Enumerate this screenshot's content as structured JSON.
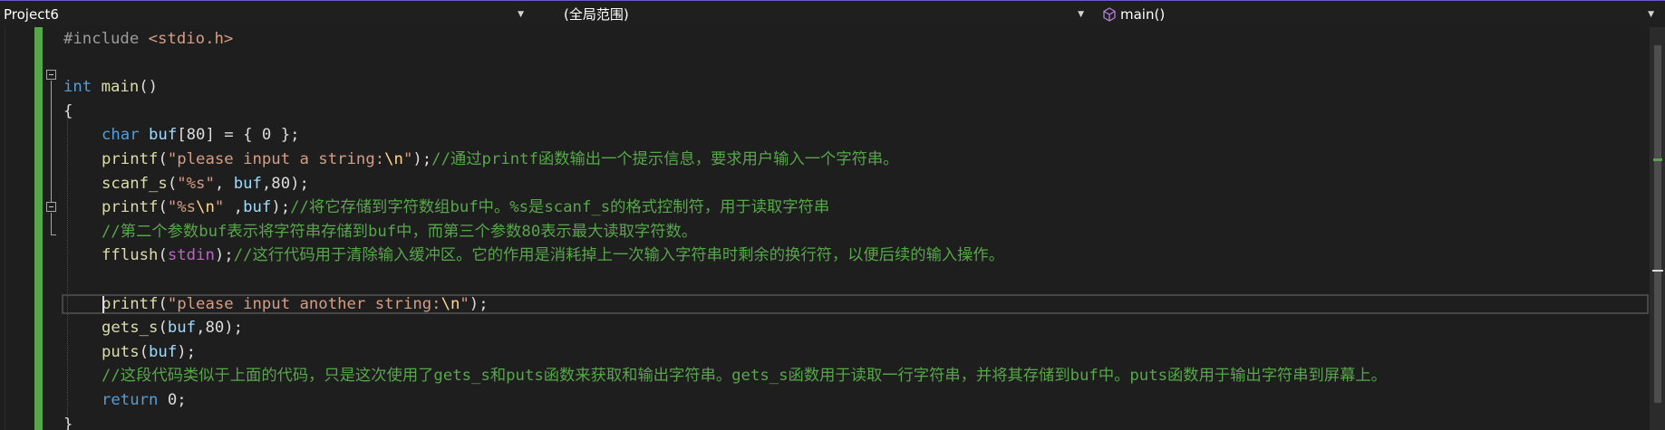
{
  "navbar": {
    "project": "Project6",
    "scope": "(全局范围)",
    "member": "main()",
    "member_icon": "method-cube-icon",
    "accent": "#6a5acd"
  },
  "editor": {
    "change_bar_color": "#57a64a",
    "lines": [
      {
        "segments": [
          {
            "c": "pp",
            "t": "#include "
          },
          {
            "c": "str",
            "t": "<stdio.h>"
          }
        ]
      },
      {
        "segments": []
      },
      {
        "segments": [
          {
            "c": "kw",
            "t": "int"
          },
          {
            "c": "",
            "t": " "
          },
          {
            "c": "fn",
            "t": "main"
          },
          {
            "c": "",
            "t": "()"
          }
        ]
      },
      {
        "segments": [
          {
            "c": "",
            "t": "{"
          }
        ]
      },
      {
        "indent": true,
        "segments": [
          {
            "c": "kw",
            "t": "char"
          },
          {
            "c": "",
            "t": " "
          },
          {
            "c": "var",
            "t": "buf"
          },
          {
            "c": "",
            "t": "[80] = { 0 };"
          }
        ]
      },
      {
        "indent": true,
        "segments": [
          {
            "c": "fn",
            "t": "printf"
          },
          {
            "c": "",
            "t": "("
          },
          {
            "c": "str",
            "t": "\"please input a string:"
          },
          {
            "c": "esc",
            "t": "\\n"
          },
          {
            "c": "str",
            "t": "\""
          },
          {
            "c": "",
            "t": ");"
          },
          {
            "c": "cmt",
            "t": "//通过printf函数输出一个提示信息，要求用户输入一个字符串。"
          }
        ]
      },
      {
        "indent": true,
        "segments": [
          {
            "c": "fn",
            "t": "scanf_s"
          },
          {
            "c": "",
            "t": "("
          },
          {
            "c": "str",
            "t": "\"%s\""
          },
          {
            "c": "",
            "t": ", "
          },
          {
            "c": "var",
            "t": "buf"
          },
          {
            "c": "",
            "t": ",80);"
          }
        ]
      },
      {
        "indent": true,
        "segments": [
          {
            "c": "fn",
            "t": "printf"
          },
          {
            "c": "",
            "t": "("
          },
          {
            "c": "str",
            "t": "\"%s"
          },
          {
            "c": "esc",
            "t": "\\n"
          },
          {
            "c": "str",
            "t": "\""
          },
          {
            "c": "",
            "t": " ,"
          },
          {
            "c": "var",
            "t": "buf"
          },
          {
            "c": "",
            "t": ");"
          },
          {
            "c": "cmt",
            "t": "//将它存储到字符数组buf中。%s是scanf_s的格式控制符，用于读取字符串"
          }
        ]
      },
      {
        "indent": true,
        "segments": [
          {
            "c": "cmt",
            "t": "//第二个参数buf表示将字符串存储到buf中，而第三个参数80表示最大读取字符数。"
          }
        ]
      },
      {
        "indent": true,
        "segments": [
          {
            "c": "fn",
            "t": "fflush"
          },
          {
            "c": "",
            "t": "("
          },
          {
            "c": "gv",
            "t": "stdin"
          },
          {
            "c": "",
            "t": ");"
          },
          {
            "c": "cmt",
            "t": "//这行代码用于清除输入缓冲区。它的作用是消耗掉上一次输入字符串时剩余的换行符，以便后续的输入操作。"
          }
        ]
      },
      {
        "segments": []
      },
      {
        "indent": true,
        "segments": [
          {
            "c": "fn",
            "t": "printf"
          },
          {
            "c": "",
            "t": "("
          },
          {
            "c": "str",
            "t": "\"please input another string:"
          },
          {
            "c": "esc",
            "t": "\\n"
          },
          {
            "c": "str",
            "t": "\""
          },
          {
            "c": "",
            "t": ");"
          }
        ]
      },
      {
        "indent": true,
        "segments": [
          {
            "c": "fn",
            "t": "gets_s"
          },
          {
            "c": "",
            "t": "("
          },
          {
            "c": "var",
            "t": "buf"
          },
          {
            "c": "",
            "t": ",80);"
          }
        ]
      },
      {
        "indent": true,
        "segments": [
          {
            "c": "fn",
            "t": "puts"
          },
          {
            "c": "",
            "t": "("
          },
          {
            "c": "var",
            "t": "buf"
          },
          {
            "c": "",
            "t": ");"
          }
        ]
      },
      {
        "indent": true,
        "segments": [
          {
            "c": "cmt",
            "t": "//这段代码类似于上面的代码，只是这次使用了gets_s和puts函数来获取和输出字符串。gets_s函数用于读取一行字符串，并将其存储到buf中。puts函数用于输出字符串到屏幕上。"
          }
        ]
      },
      {
        "indent": true,
        "segments": [
          {
            "c": "kw",
            "t": "return"
          },
          {
            "c": "",
            "t": " 0;"
          }
        ]
      },
      {
        "segments": [
          {
            "c": "",
            "t": "}"
          }
        ]
      }
    ]
  }
}
